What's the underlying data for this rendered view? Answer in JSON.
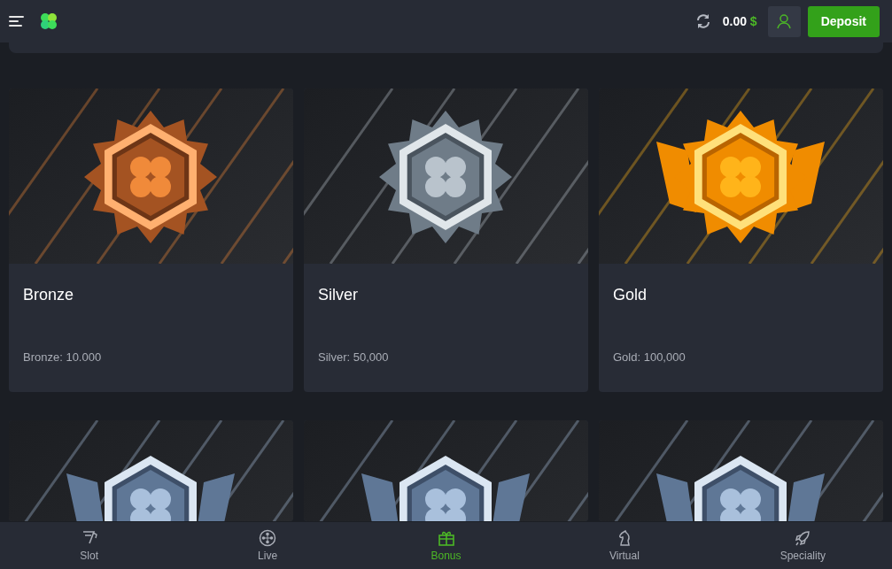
{
  "header": {
    "balance": "0.00",
    "currency": "$",
    "deposit_label": "Deposit"
  },
  "tiers": [
    {
      "kind": "bronze",
      "title": "Bronze",
      "requirement": "Bronze: 10.000"
    },
    {
      "kind": "silver",
      "title": "Silver",
      "requirement": "Silver: 50,000"
    },
    {
      "kind": "gold",
      "title": "Gold",
      "requirement": "Gold: 100,000"
    },
    {
      "kind": "platinum"
    },
    {
      "kind": "platinum"
    },
    {
      "kind": "platinum"
    }
  ],
  "bottom_nav": [
    {
      "kind": "slot",
      "label": "Slot",
      "selected": false
    },
    {
      "kind": "live",
      "label": "Live",
      "selected": false
    },
    {
      "kind": "bonus",
      "label": "Bonus",
      "selected": true
    },
    {
      "kind": "virtual",
      "label": "Virtual",
      "selected": false
    },
    {
      "kind": "speciality",
      "label": "Speciality",
      "selected": false
    }
  ]
}
